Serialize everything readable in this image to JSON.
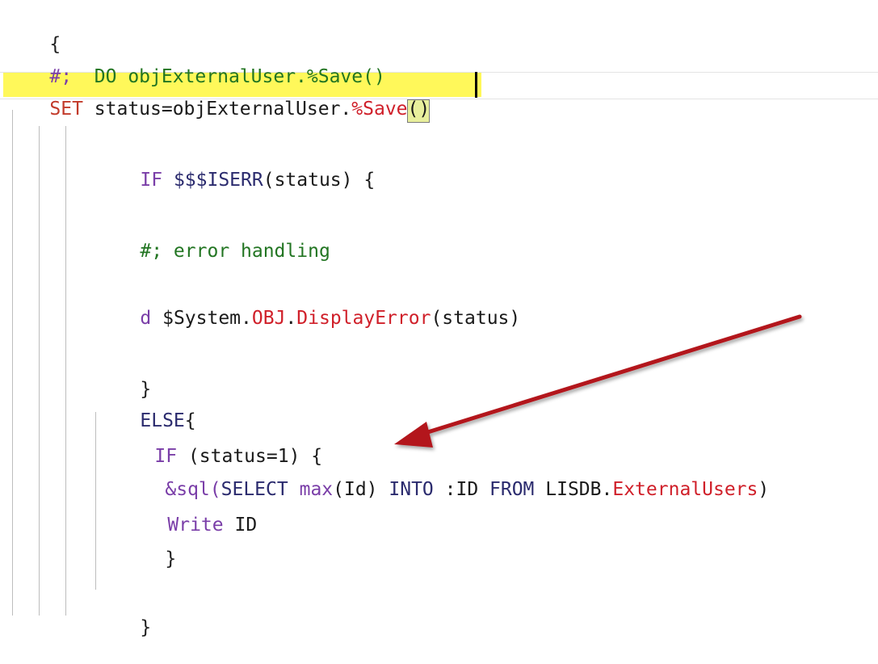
{
  "editor": {
    "line1": {
      "brace": "{"
    },
    "line2": {
      "comment_prefix": "#;",
      "comment_text": "  DO objExternalUser.%Save()"
    },
    "line3": {
      "set": "SET",
      "assign": " status=objExternalUser.",
      "method": "%Save",
      "paren_open": "(",
      "paren_close": ")"
    },
    "line4": {
      "if": "IF",
      "macro": " $$$ISERR",
      "rest": "(status) {"
    },
    "line5": {
      "comment": "#; error handling"
    },
    "line6": {
      "do": "d ",
      "sys": "$System.",
      "obj": "OBJ",
      "dot": ".",
      "method": "DisplayError",
      "args": "(status)"
    },
    "line7": {
      "brace": "}"
    },
    "line8": {
      "else": "ELSE",
      "brace": "{"
    },
    "line9": {
      "if": "IF",
      "rest": " (status=1) {"
    },
    "line10": {
      "sql_kw": "&sql(",
      "select": "SELECT",
      "sp1": " ",
      "max": "max",
      "arg": "(Id)",
      "into": " INTO",
      "host": " :ID",
      "from": " FROM",
      "table_prefix": " LISDB.",
      "table": "ExternalUsers",
      "close": ")"
    },
    "line11": {
      "write": "Write",
      "var": " ID"
    },
    "line12": {
      "brace": "}"
    },
    "line14": {
      "brace": "}"
    }
  },
  "colors": {
    "keyword": "#7a3ea8",
    "comment": "#227522",
    "string_method": "#d0202a",
    "highlight": "#fff85a",
    "arrow": "#b3191b"
  }
}
